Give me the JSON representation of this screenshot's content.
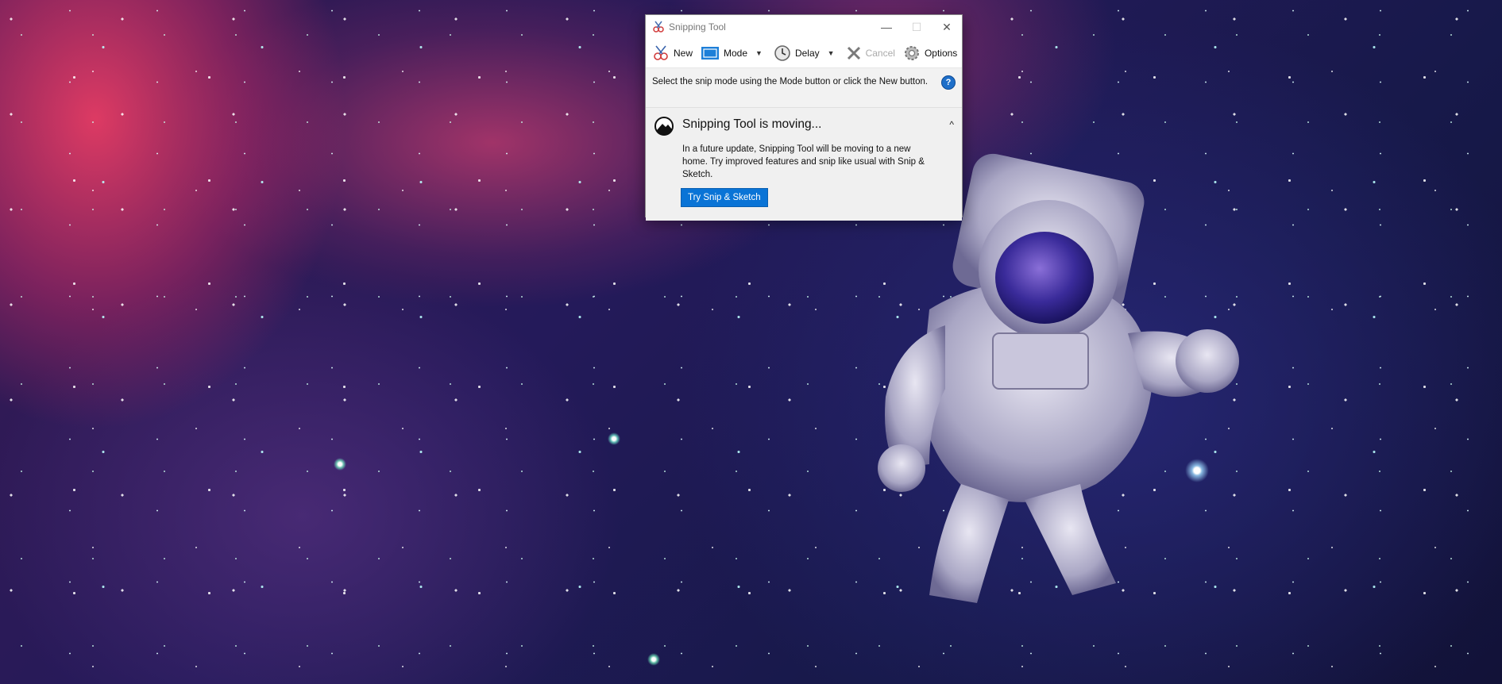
{
  "window": {
    "title": "Snipping Tool",
    "controls": {
      "minimize": "—",
      "maximize": "☐",
      "close": "✕"
    }
  },
  "toolbar": {
    "new_label": "New",
    "mode_label": "Mode",
    "delay_label": "Delay",
    "cancel_label": "Cancel",
    "options_label": "Options"
  },
  "hint": {
    "text": "Select the snip mode using the Mode button or click the New button.",
    "help": "?"
  },
  "notice": {
    "title": "Snipping Tool is moving...",
    "body": "In a future update, Snipping Tool will be moving to a new home. Try improved features and snip like usual with Snip & Sketch.",
    "button_label": "Try Snip & Sketch",
    "collapse": "^"
  },
  "colors": {
    "accent": "#0a74d6",
    "help_icon": "#1e6fc9"
  },
  "icons": [
    "snipping-tool-icon",
    "scissors-icon",
    "mode-rect-icon",
    "clock-icon",
    "cancel-x-icon",
    "gear-icon",
    "help-icon",
    "snip-sketch-icon",
    "chevron-up-icon"
  ]
}
